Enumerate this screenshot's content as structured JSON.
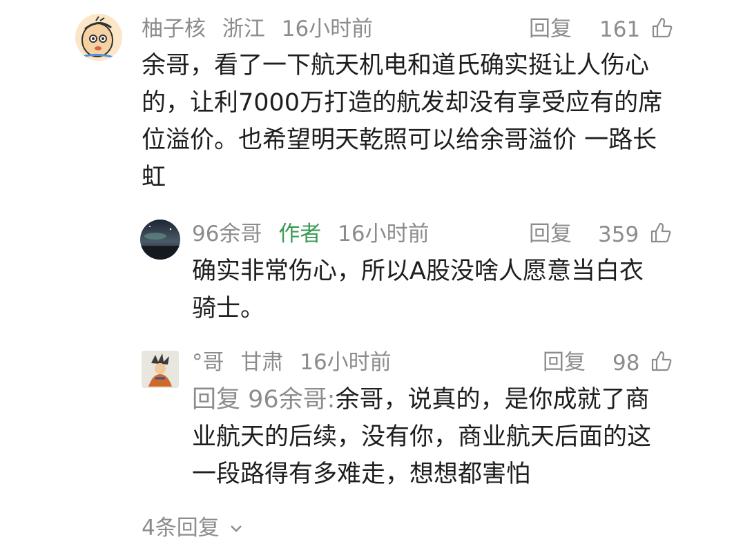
{
  "comments": [
    {
      "user": "柚子核",
      "location": "浙江",
      "time": "16小时前",
      "reply_label": "回复",
      "likes": "161",
      "lines": [
        "余哥，看了一下航天机电和道氏确实挺让人伤心",
        "的，让利7000万打造的航发却没有享受应有的席",
        "位溢价。也希望明天乾照可以给余哥溢价 一路长",
        "虹"
      ]
    },
    {
      "user": "96余哥",
      "author_tag": "作者",
      "time": "16小时前",
      "reply_label": "回复",
      "likes": "359",
      "lines": [
        "确实非常伤心，所以A股没啥人愿意当白衣",
        "骑士。"
      ]
    },
    {
      "user": "°哥",
      "location": "甘肃",
      "time": "16小时前",
      "reply_label": "回复",
      "likes": "98",
      "reply_prefix": "回复 96余哥:",
      "lines": [
        "余哥，说真的，是你成就了商",
        "业航天的后续，没有你，商业航天后面的这",
        "一段路得有多难走，想想都害怕"
      ]
    }
  ],
  "more_replies": "4条回复",
  "icons": {
    "like": "thumbs-up-icon",
    "expand": "chevron-down-icon"
  }
}
